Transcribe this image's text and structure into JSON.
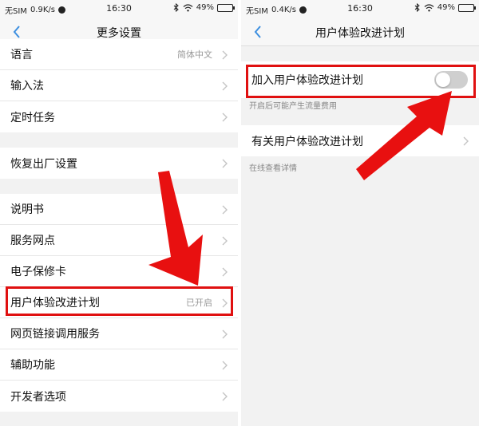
{
  "status_bar_left": {
    "carrier": "无SIM",
    "speed": "0.9K/s",
    "time": "16:30",
    "battery": "49%",
    "battery_level": 0.49
  },
  "status_bar_right": {
    "carrier": "无SIM",
    "speed": "0.4K/s",
    "time": "16:30",
    "battery": "49%",
    "battery_level": 0.49
  },
  "left_screen": {
    "title": "更多设置",
    "language": {
      "label": "语言",
      "value": "简体中文"
    },
    "input_method": {
      "label": "输入法"
    },
    "scheduled_tasks": {
      "label": "定时任务"
    },
    "factory_reset": {
      "label": "恢复出厂设置"
    },
    "manual": {
      "label": "说明书"
    },
    "service_outlets": {
      "label": "服务网点"
    },
    "warranty_card": {
      "label": "电子保修卡"
    },
    "ux_program": {
      "label": "用户体验改进计划",
      "value": "已开启"
    },
    "web_link_service": {
      "label": "网页链接调用服务"
    },
    "accessibility": {
      "label": "辅助功能"
    },
    "developer_options": {
      "label": "开发者选项"
    }
  },
  "right_screen": {
    "title": "用户体验改进计划",
    "join_program": {
      "label": "加入用户体验改进计划",
      "enabled": false
    },
    "join_hint": "开启后可能产生流量费用",
    "about_program": {
      "label": "有关用户体验改进计划"
    },
    "about_hint": "在线查看详情"
  },
  "colors": {
    "highlight": "#e01010",
    "toggle_off": "#cfcfcf",
    "accent_back": "#3d8fe0"
  }
}
